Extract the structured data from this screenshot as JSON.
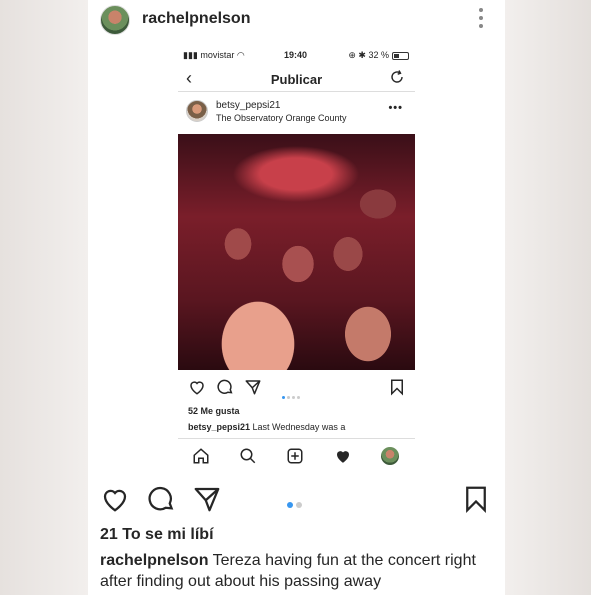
{
  "outer_post": {
    "username": "rachelpnelson",
    "likes": "21 To se mi líbí",
    "caption_user": "rachelpnelson",
    "caption_text": " Tereza having fun at the concert right after finding out about his passing away",
    "carousel": {
      "count": 2,
      "active": 1
    }
  },
  "inner_screen": {
    "status": {
      "carrier": "movistar",
      "time": "19:40",
      "battery": "32 %"
    },
    "nav_title": "Publicar",
    "post": {
      "username": "betsy_pepsi21",
      "location": "The Observatory Orange County",
      "likes": "52 Me gusta",
      "caption_user": "betsy_pepsi21",
      "caption_text": " Last Wednesday was a",
      "carousel": {
        "count": 4,
        "active": 1
      }
    }
  },
  "icons": [
    "heart-icon",
    "comment-icon",
    "share-icon",
    "bookmark-icon",
    "home-icon",
    "search-icon",
    "add-icon",
    "activity-icon",
    "more-icon",
    "back-icon",
    "refresh-icon"
  ],
  "colors": {
    "accent": "#3897f0",
    "text": "#262626",
    "photo_tint": "#8a1e2c"
  }
}
